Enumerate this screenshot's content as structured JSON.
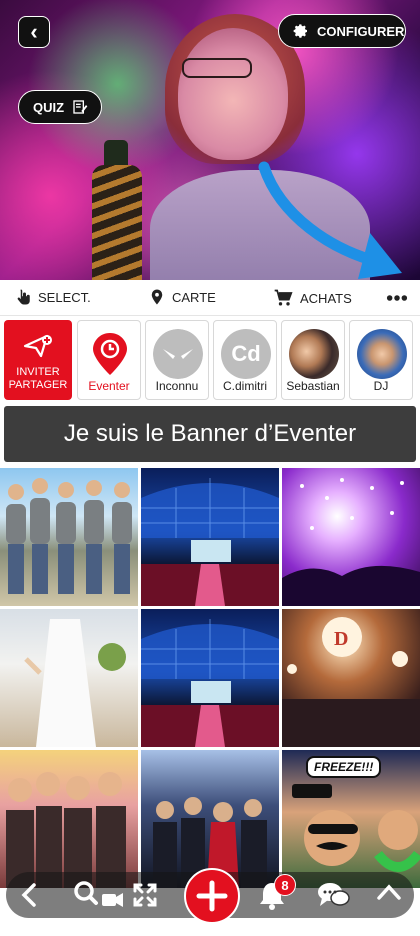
{
  "header": {
    "configure_label": "CONFIGURER",
    "quiz_label": "QUIZ"
  },
  "toolbar": {
    "select_label": "SELECT.",
    "map_label": "CARTE",
    "purchases_label": "ACHATS"
  },
  "guests": {
    "invite_line1": "INVITER",
    "invite_line2": "PARTAGER",
    "items": [
      {
        "name": "Eventer"
      },
      {
        "name": "Inconnu"
      },
      {
        "name": "C.dimitri",
        "initials": "Cd"
      },
      {
        "name": "Sebastian"
      },
      {
        "name": "DJ"
      }
    ]
  },
  "banner": {
    "text": "Je suis le Banner d’Eventer"
  },
  "grid": {
    "freeze_text": "FREEZE!!!"
  },
  "bottom_nav": {
    "notifications_count": "8"
  },
  "colors": {
    "accent": "#e3101f",
    "banner_bg": "#3d3d3d",
    "arrow": "#1e90e6"
  }
}
